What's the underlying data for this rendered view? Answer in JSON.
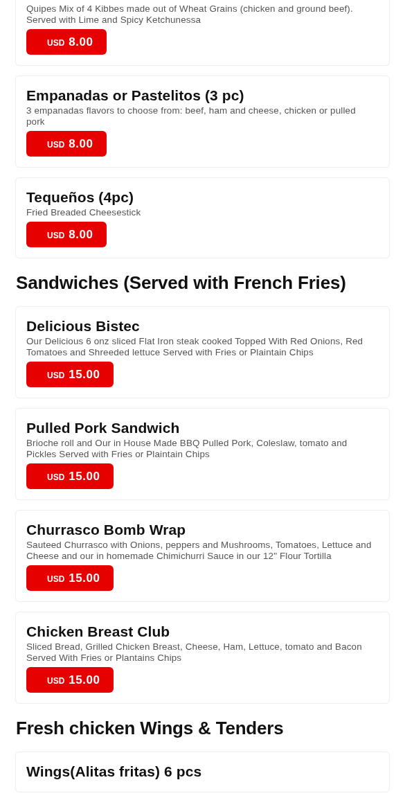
{
  "sections": [
    {
      "items": [
        {
          "description": "Quipes Mix of 4 Kibbes made out of Wheat Grains (chicken and ground beef). Served with Lime and Spicy Ketchunessa",
          "price": {
            "currency": "USD",
            "amount": "8.00"
          }
        },
        {
          "title": "Empanadas or Pastelitos (3 pc)",
          "description": "3 empanadas flavors to choose from: beef, ham and cheese, chicken or pulled pork",
          "price": {
            "currency": "USD",
            "amount": "8.00"
          }
        },
        {
          "title": "Tequeños (4pc)",
          "description": "Fried Breaded Cheesestick",
          "price": {
            "currency": "USD",
            "amount": "8.00"
          }
        }
      ]
    },
    {
      "heading": "Sandwiches (Served with French Fries)",
      "items": [
        {
          "title": "Delicious Bistec",
          "description": "Our Delicious 6 onz sliced Flat Iron steak cooked Topped With Red Onions, Red Tomatoes and Shreeded lettuce Served with Fries or Plaintain Chips",
          "price": {
            "currency": "USD",
            "amount": "15.00"
          }
        },
        {
          "title": "Pulled Pork Sandwich",
          "description": "Brioche roll and Our in House Made BBQ Pulled Pork, Coleslaw, tomato and Pickles Served with Fries or Plaintain Chips",
          "price": {
            "currency": "USD",
            "amount": "15.00"
          }
        },
        {
          "title": "Churrasco Bomb Wrap",
          "description": "Sauteed Churrasco with Onions, peppers and Mushrooms, Tomatoes, Lettuce and Cheese and our in homemade Chimichurri Sauce in our 12\" Flour Tortilla",
          "price": {
            "currency": "USD",
            "amount": "15.00"
          }
        },
        {
          "title": "Chicken Breast Club",
          "description": "Sliced Bread, Grilled Chicken Breast, Cheese, Ham, Lettuce, tomato and Bacon  Served With Fries or Plantains Chips",
          "price": {
            "currency": "USD",
            "amount": "15.00"
          }
        }
      ]
    },
    {
      "heading": "Fresh chicken Wings & Tenders",
      "items": [
        {
          "title": "Wings(Alitas fritas) 6 pcs"
        }
      ]
    }
  ]
}
